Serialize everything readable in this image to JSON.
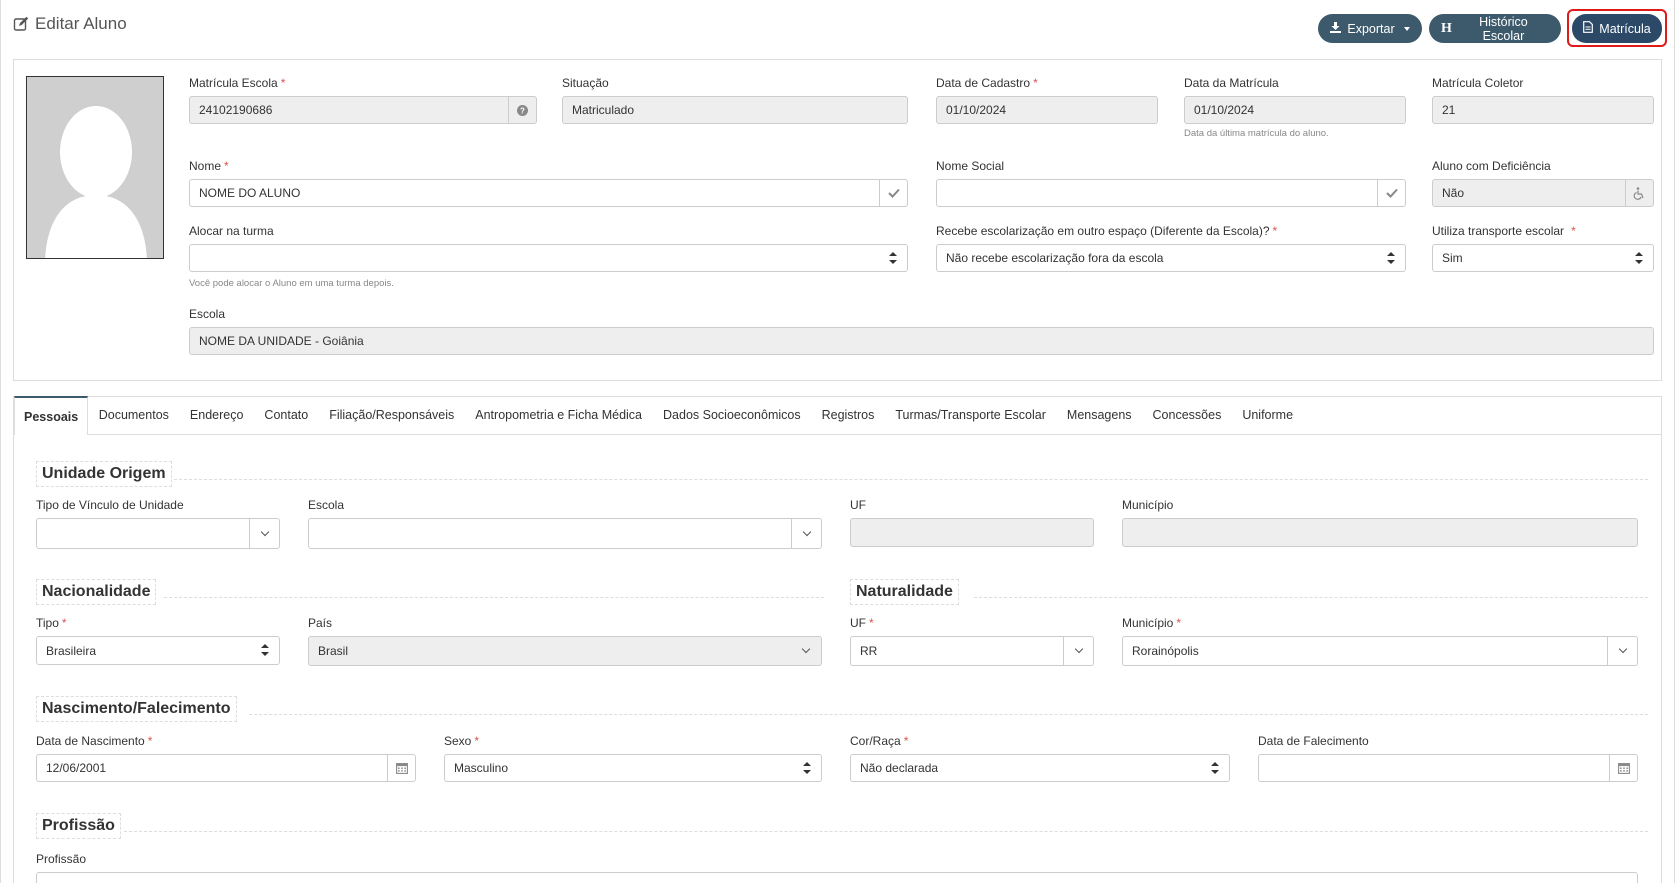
{
  "header": {
    "title": "Editar Aluno",
    "export_label": "Exportar",
    "historico_label": "Histórico Escolar",
    "historico_letter": "H",
    "matricula_label": "Matrícula"
  },
  "top": {
    "matricula_escola": {
      "label": "Matrícula Escola",
      "value": "24102190686"
    },
    "situacao": {
      "label": "Situação",
      "value": "Matriculado"
    },
    "data_cadastro": {
      "label": "Data de Cadastro",
      "value": "01/10/2024"
    },
    "data_matricula": {
      "label": "Data da Matrícula",
      "value": "01/10/2024",
      "help": "Data da última matrícula do aluno."
    },
    "matricula_coletor": {
      "label": "Matrícula Coletor",
      "value": "21"
    },
    "nome": {
      "label": "Nome",
      "value": "NOME DO ALUNO"
    },
    "nome_social": {
      "label": "Nome Social",
      "value": ""
    },
    "aluno_deficiencia": {
      "label": "Aluno com Deficiência",
      "value": "Não"
    },
    "alocar_turma": {
      "label": "Alocar na turma",
      "value": "",
      "help": "Você pode alocar o Aluno em uma turma depois."
    },
    "escolarizacao": {
      "label": "Recebe escolarização em outro espaço (Diferente da Escola)?",
      "value": "Não recebe escolarização fora da escola"
    },
    "transporte": {
      "label": "Utiliza transporte escolar",
      "value": "Sim"
    },
    "escola": {
      "label": "Escola",
      "value": "NOME DA UNIDADE - Goiânia"
    }
  },
  "tabs": [
    {
      "label": "Pessoais"
    },
    {
      "label": "Documentos"
    },
    {
      "label": "Endereço"
    },
    {
      "label": "Contato"
    },
    {
      "label": "Filiação/Responsáveis"
    },
    {
      "label": "Antropometria e Ficha Médica"
    },
    {
      "label": "Dados Socioeconômicos"
    },
    {
      "label": "Registros"
    },
    {
      "label": "Turmas/Transporte Escolar"
    },
    {
      "label": "Mensagens"
    },
    {
      "label": "Concessões"
    },
    {
      "label": "Uniforme"
    }
  ],
  "unidade_origem": {
    "title": "Unidade Origem",
    "tipo_vinculo": {
      "label": "Tipo de Vínculo de Unidade",
      "value": ""
    },
    "escola": {
      "label": "Escola",
      "value": ""
    },
    "uf": {
      "label": "UF",
      "value": ""
    },
    "municipio": {
      "label": "Município",
      "value": ""
    }
  },
  "nacionalidade": {
    "title": "Nacionalidade",
    "tipo": {
      "label": "Tipo",
      "value": "Brasileira"
    },
    "pais": {
      "label": "País",
      "value": "Brasil"
    }
  },
  "naturalidade": {
    "title": "Naturalidade",
    "uf": {
      "label": "UF",
      "value": "RR"
    },
    "municipio": {
      "label": "Município",
      "value": "Rorainópolis"
    }
  },
  "nascimento": {
    "title": "Nascimento/Falecimento",
    "data_nascimento": {
      "label": "Data de Nascimento",
      "value": "12/06/2001"
    },
    "sexo": {
      "label": "Sexo",
      "value": "Masculino"
    },
    "cor_raca": {
      "label": "Cor/Raça",
      "value": "Não declarada"
    },
    "data_falecimento": {
      "label": "Data de Falecimento",
      "value": ""
    }
  },
  "profissao": {
    "title": "Profissão",
    "profissao": {
      "label": "Profissão",
      "value": ""
    }
  },
  "required_mark": "*",
  "colors": {
    "button": "#3d5a6c",
    "highlight": "#e01919",
    "required": "#d9534f"
  }
}
